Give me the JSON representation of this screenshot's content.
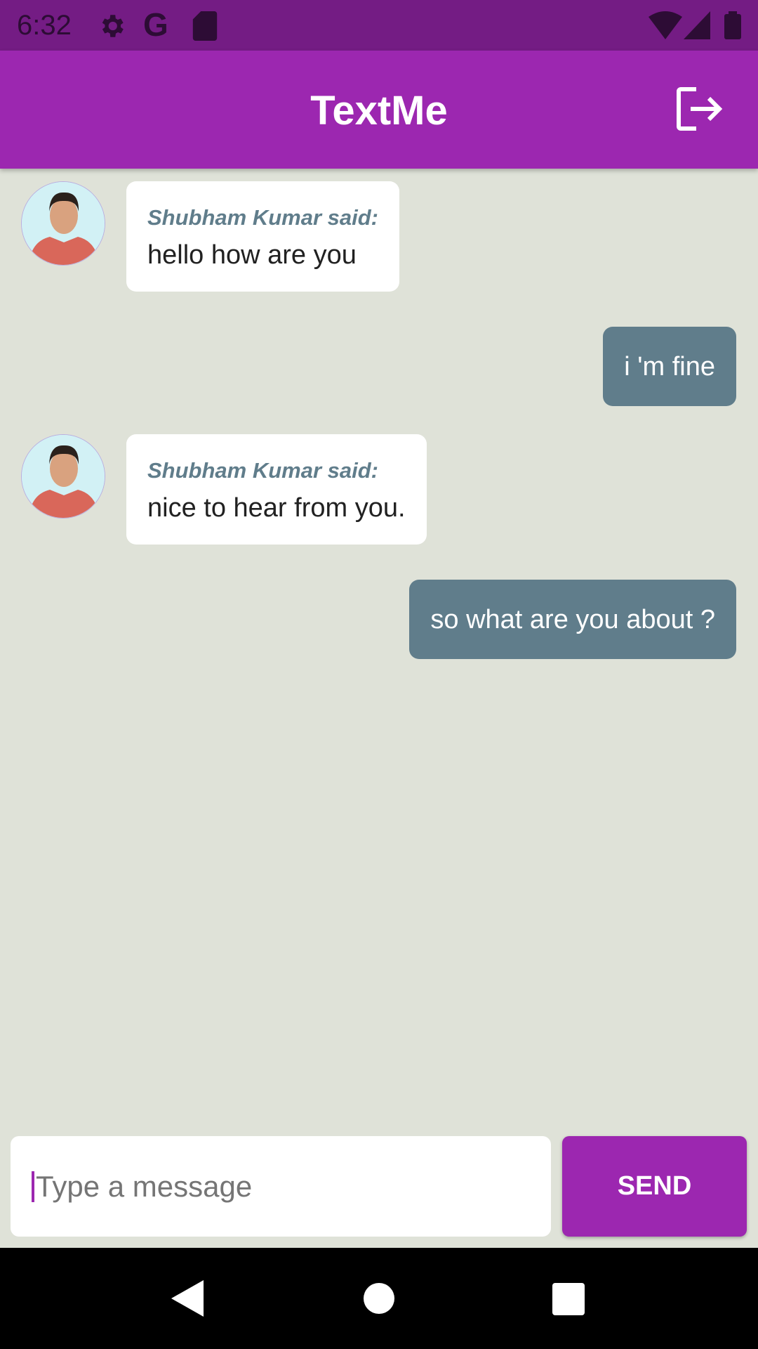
{
  "status_bar": {
    "time": "6:32",
    "icons": [
      "gear-icon",
      "google-icon",
      "sd-card-icon",
      "wifi-icon",
      "signal-icon",
      "battery-icon"
    ]
  },
  "app_bar": {
    "title": "TextMe",
    "action_icon": "logout-icon"
  },
  "messages": [
    {
      "type": "received",
      "sender_label": "Shubham Kumar said:",
      "text": "hello how are you"
    },
    {
      "type": "sent",
      "text": "i 'm fine"
    },
    {
      "type": "received",
      "sender_label": "Shubham Kumar said:",
      "text": "nice to hear from you."
    },
    {
      "type": "sent",
      "text": "so what are you about ?"
    }
  ],
  "composer": {
    "placeholder": "Type a message",
    "send_label": "SEND"
  },
  "colors": {
    "primary": "#9c27b0",
    "status_bar": "#741c84",
    "sent_bubble": "#607d8b",
    "background": "#dfe2d8"
  }
}
